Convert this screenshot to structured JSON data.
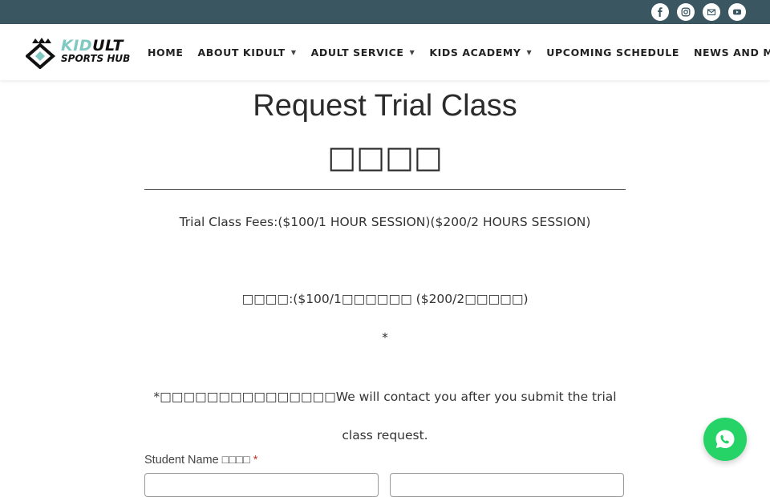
{
  "social": {
    "icons": [
      "facebook-icon",
      "instagram-icon",
      "email-icon",
      "youtube-icon"
    ],
    "bar_color": "#3a5660"
  },
  "logo": {
    "line1_accent": "KID",
    "line1_rest": "ULT",
    "line2": "SPORTS HUB",
    "accent_color": "#7fc9c2"
  },
  "nav": {
    "items": [
      {
        "label": "HOME",
        "has_dropdown": false
      },
      {
        "label": "ABOUT KIDULT",
        "has_dropdown": true
      },
      {
        "label": "ADULT SERVICE",
        "has_dropdown": true
      },
      {
        "label": "KIDS ACADEMY",
        "has_dropdown": true
      },
      {
        "label": "UPCOMING SCHEDULE",
        "has_dropdown": false
      },
      {
        "label": "NEWS AND MED",
        "has_dropdown": false
      }
    ],
    "caret": "▼"
  },
  "main": {
    "title": "Request Trial Class",
    "title_cjk": "□□□□",
    "fees": "Trial Class Fees:($100/1 HOUR SESSION)($200/2 HOURS SESSION)",
    "fees_cjk": "□□□□:($100/1□□□□□□ ($200/2□□□□□)",
    "star": "*",
    "contact": "*□□□□□□□□□□□□□□□We will contact you after you submit the trial class request."
  },
  "form": {
    "student_name_label": "Student Name □□□□",
    "required_mark": "*"
  },
  "chat": {
    "icon": "whatsapp-icon",
    "color": "#25d366"
  }
}
